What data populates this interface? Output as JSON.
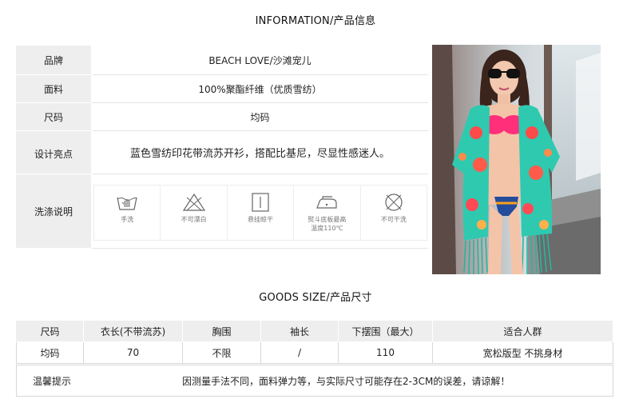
{
  "section1": {
    "title": "INFORMATION/产品信息"
  },
  "info": {
    "brand": {
      "label": "品牌",
      "value": "BEACH LOVE/沙滩宠儿"
    },
    "material": {
      "label": "面料",
      "value": "100%聚酯纤维（优质雪纺）"
    },
    "size": {
      "label": "尺码",
      "value": "均码"
    },
    "highlight": {
      "label": "设计亮点",
      "value": "蓝色雪纺印花带流苏开衫，搭配比基尼，尽显性感迷人。"
    },
    "care": {
      "label": "洗涤说明",
      "items": [
        {
          "icon": "hand-wash-icon",
          "text": "手洗"
        },
        {
          "icon": "no-bleach-icon",
          "text": "不可漂白"
        },
        {
          "icon": "hang-dry-icon",
          "text": "悬挂晾干"
        },
        {
          "icon": "iron-icon",
          "text": "熨斗底板最高\n温度110℃"
        },
        {
          "icon": "no-dry-clean-icon",
          "text": "不可干洗"
        }
      ]
    }
  },
  "section2": {
    "title": "GOODS SIZE/产品尺寸"
  },
  "size_table": {
    "headers": [
      "尺码",
      "衣长(不带流苏)",
      "胸围",
      "袖长",
      "下摆围（最大）",
      "适合人群"
    ],
    "row": [
      "均码",
      "70",
      "不限",
      "/",
      "110",
      "宽松版型 不挑身材"
    ],
    "tip_label": "温馨提示",
    "tip_text": "因测量手法不同，面料弹力等，与实际尺寸可能存在2-3CM的误差，请谅解！"
  },
  "colors": {
    "label_bg": "#eeeeee",
    "border": "#d7d7d7",
    "kimono": "#2fc9b0",
    "bikini": "#ff2f7a"
  }
}
